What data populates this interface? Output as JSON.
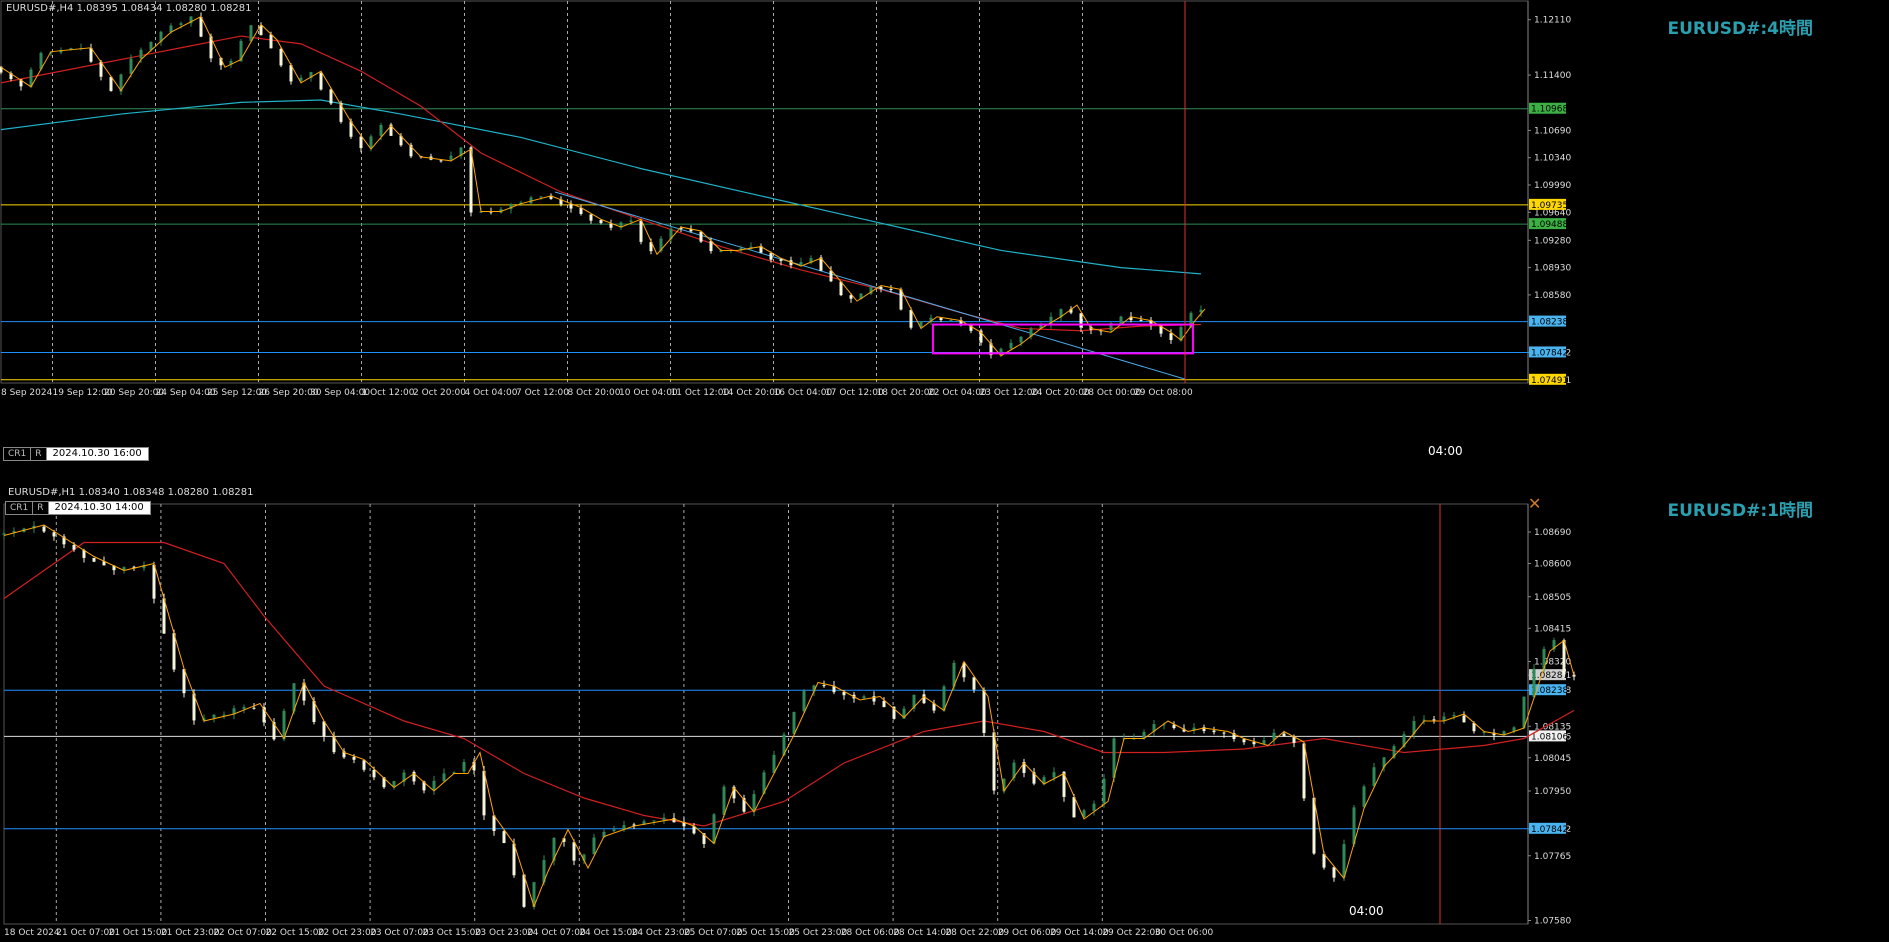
{
  "top": {
    "header": "EURUSD#,H4  1.08395 1.08434 1.08280 1.08281",
    "symbol_title": "EURUSD#:4時間",
    "cr_label": "CR1",
    "r_label": "R",
    "datetime_box": "2024.10.30 16:00",
    "cursor_time_label": "04:00"
  },
  "bottom": {
    "header": "EURUSD#,H1  1.08340 1.08348 1.08280 1.08281",
    "symbol_title": "EURUSD#:1時間",
    "cr_label": "CR1",
    "r_label": "R",
    "datetime_box": "2024.10.30 14:00",
    "cursor_time_label": "04:00"
  },
  "colors": {
    "background": "#000000",
    "bull_candle": "#2e8b57",
    "bear_candle": "#f5f5dc",
    "ma_red": "#d02020",
    "ma_cyan": "#20b2c8",
    "zigzag": "#ffa500",
    "hline_blue": "#1e90ff",
    "hline_green": "#2e8b57",
    "hline_yellow": "#ffd700",
    "magenta_box": "#ff00ff",
    "trendline": "#4aa8e8",
    "vertical_marker": "#e03030",
    "title_color": "#2a9fb0"
  },
  "chart_data": [
    {
      "type": "candlestick",
      "title": "EURUSD#:4時間",
      "timeframe": "H4",
      "ylim": [
        1.0745,
        1.1235
      ],
      "y_ticks": [
        "1.12110",
        "1.11400",
        "1.10690",
        "1.10340",
        "1.09990",
        "1.09640",
        "1.09280",
        "1.08930",
        "1.08580",
        "1.07842",
        "1.07491"
      ],
      "price_labels": [
        {
          "text": "1.10968",
          "price": 1.10968,
          "kind": "green"
        },
        {
          "text": "1.09735",
          "price": 1.09735,
          "kind": "yellow"
        },
        {
          "text": "1.09488",
          "price": 1.09488,
          "kind": "green"
        },
        {
          "text": "1.08238",
          "price": 1.08238,
          "kind": "blue"
        },
        {
          "text": "1.07842",
          "price": 1.07842,
          "kind": "blue"
        },
        {
          "text": "1.07491",
          "price": 1.07491,
          "kind": "yellow"
        }
      ],
      "x_ticks": [
        "8 Sep 2024",
        "19 Sep 12:00",
        "20 Sep 20:00",
        "24 Sep 04:00",
        "25 Sep 12:00",
        "26 Sep 20:00",
        "30 Sep 04:00",
        "1 Oct 12:00",
        "2 Oct 20:00",
        "4 Oct 04:00",
        "7 Oct 12:00",
        "8 Oct 20:00",
        "10 Oct 04:00",
        "11 Oct 12:00",
        "14 Oct 20:00",
        "16 Oct 04:00",
        "17 Oct 12:00",
        "18 Oct 20:00",
        "22 Oct 04:00",
        "23 Oct 12:00",
        "24 Oct 20:00",
        "28 Oct 00:00",
        "29 Oct 08:00"
      ],
      "path": [
        [
          0,
          1.115
        ],
        [
          15,
          1.1125
        ],
        [
          25,
          1.117
        ],
        [
          45,
          1.1175
        ],
        [
          60,
          1.112
        ],
        [
          70,
          1.116
        ],
        [
          85,
          1.1195
        ],
        [
          100,
          1.1215
        ],
        [
          112,
          1.115
        ],
        [
          120,
          1.116
        ],
        [
          130,
          1.1205
        ],
        [
          138,
          1.1185
        ],
        [
          150,
          1.113
        ],
        [
          160,
          1.1145
        ],
        [
          175,
          1.108
        ],
        [
          185,
          1.1045
        ],
        [
          195,
          1.1075
        ],
        [
          210,
          1.1035
        ],
        [
          225,
          1.103
        ],
        [
          235,
          1.1045
        ],
        [
          240,
          1.0965
        ],
        [
          250,
          1.0965
        ],
        [
          260,
          1.0975
        ],
        [
          275,
          1.0985
        ],
        [
          290,
          1.097
        ],
        [
          300,
          1.0955
        ],
        [
          310,
          1.0945
        ],
        [
          320,
          1.0955
        ],
        [
          328,
          1.091
        ],
        [
          340,
          1.0945
        ],
        [
          350,
          1.094
        ],
        [
          360,
          1.0915
        ],
        [
          368,
          1.0915
        ],
        [
          380,
          1.092
        ],
        [
          390,
          1.0905
        ],
        [
          400,
          1.0895
        ],
        [
          410,
          1.0905
        ],
        [
          420,
          1.0875
        ],
        [
          428,
          1.085
        ],
        [
          440,
          1.087
        ],
        [
          450,
          1.0865
        ],
        [
          460,
          1.0815
        ],
        [
          468,
          1.083
        ],
        [
          480,
          1.0825
        ],
        [
          490,
          1.081
        ],
        [
          500,
          1.078
        ],
        [
          510,
          1.0795
        ],
        [
          520,
          1.0815
        ],
        [
          530,
          1.083
        ],
        [
          538,
          1.0845
        ],
        [
          545,
          1.0815
        ],
        [
          555,
          1.081
        ],
        [
          565,
          1.083
        ],
        [
          575,
          1.0825
        ],
        [
          585,
          1.081
        ],
        [
          590,
          1.08
        ],
        [
          597,
          1.0825
        ],
        [
          602,
          1.084
        ]
      ],
      "ma_red": [
        [
          0,
          1.113
        ],
        [
          40,
          1.115
        ],
        [
          90,
          1.1175
        ],
        [
          120,
          1.119
        ],
        [
          150,
          1.118
        ],
        [
          180,
          1.1145
        ],
        [
          210,
          1.11
        ],
        [
          240,
          1.104
        ],
        [
          280,
          1.099
        ],
        [
          320,
          1.0955
        ],
        [
          360,
          1.092
        ],
        [
          400,
          1.089
        ],
        [
          440,
          1.0865
        ],
        [
          480,
          1.0835
        ],
        [
          510,
          1.0815
        ],
        [
          540,
          1.0812
        ],
        [
          570,
          1.0818
        ],
        [
          600,
          1.082
        ]
      ],
      "ma_cyan": [
        [
          0,
          1.107
        ],
        [
          60,
          1.109
        ],
        [
          120,
          1.1105
        ],
        [
          160,
          1.1108
        ],
        [
          200,
          1.109
        ],
        [
          260,
          1.106
        ],
        [
          320,
          1.102
        ],
        [
          380,
          1.0985
        ],
        [
          440,
          1.095
        ],
        [
          500,
          1.0915
        ],
        [
          560,
          1.0893
        ],
        [
          600,
          1.0885
        ]
      ],
      "magenta_box": {
        "x0": 466,
        "x1": 596,
        "y0": 1.0783,
        "y1": 1.082
      },
      "trendline": [
        [
          277,
          1.099
        ],
        [
          592,
          1.075
        ]
      ],
      "cursor_x": 592
    },
    {
      "type": "candlestick",
      "title": "EURUSD#:1時間",
      "timeframe": "H1",
      "ylim": [
        1.0757,
        1.0877
      ],
      "y_ticks": [
        "1.08690",
        "1.08600",
        "1.08505",
        "1.08415",
        "1.08320",
        "1.08281",
        "1.08238",
        "1.08135",
        "1.08106",
        "1.08045",
        "1.07950",
        "1.07842",
        "1.07765",
        "1.07580"
      ],
      "price_labels": [
        {
          "text": "1.08281",
          "price": 1.08281,
          "kind": "gray"
        },
        {
          "text": "1.08238",
          "price": 1.08238,
          "kind": "blue"
        },
        {
          "text": "1.08106",
          "price": 1.08106,
          "kind": "white"
        },
        {
          "text": "1.07842",
          "price": 1.07842,
          "kind": "blue"
        }
      ],
      "x_ticks": [
        "18 Oct 2024",
        "21 Oct 07:00",
        "21 Oct 15:00",
        "21 Oct 23:00",
        "22 Oct 07:00",
        "22 Oct 15:00",
        "22 Oct 23:00",
        "23 Oct 07:00",
        "23 Oct 15:00",
        "23 Oct 23:00",
        "24 Oct 07:00",
        "24 Oct 15:00",
        "24 Oct 23:00",
        "25 Oct 07:00",
        "25 Oct 15:00",
        "25 Oct 23:00",
        "28 Oct 06:00",
        "28 Oct 14:00",
        "28 Oct 22:00",
        "29 Oct 06:00",
        "29 Oct 14:00",
        "29 Oct 22:00",
        "30 Oct 06:00"
      ],
      "path": [
        [
          0,
          1.0868
        ],
        [
          20,
          1.0871
        ],
        [
          45,
          1.0862
        ],
        [
          60,
          1.0858
        ],
        [
          75,
          1.086
        ],
        [
          90,
          1.083
        ],
        [
          100,
          1.0815
        ],
        [
          115,
          1.0817
        ],
        [
          128,
          1.082
        ],
        [
          140,
          1.081
        ],
        [
          150,
          1.0826
        ],
        [
          160,
          1.0815
        ],
        [
          170,
          1.0806
        ],
        [
          180,
          1.0804
        ],
        [
          195,
          1.0796
        ],
        [
          205,
          1.08
        ],
        [
          215,
          1.0795
        ],
        [
          225,
          1.08
        ],
        [
          232,
          1.08
        ],
        [
          238,
          1.0806
        ],
        [
          245,
          1.0788
        ],
        [
          255,
          1.078
        ],
        [
          265,
          1.0762
        ],
        [
          272,
          1.0772
        ],
        [
          282,
          1.0784
        ],
        [
          292,
          1.0773
        ],
        [
          300,
          1.0782
        ],
        [
          315,
          1.0785
        ],
        [
          325,
          1.0786
        ],
        [
          335,
          1.0787
        ],
        [
          345,
          1.0785
        ],
        [
          355,
          1.078
        ],
        [
          365,
          1.0796
        ],
        [
          375,
          1.0789
        ],
        [
          385,
          1.08
        ],
        [
          395,
          1.0811
        ],
        [
          407,
          1.0826
        ],
        [
          415,
          1.0825
        ],
        [
          428,
          1.0821
        ],
        [
          438,
          1.0822
        ],
        [
          450,
          1.0816
        ],
        [
          460,
          1.0822
        ],
        [
          470,
          1.0818
        ],
        [
          480,
          1.0832
        ],
        [
          492,
          1.0822
        ],
        [
          500,
          1.0795
        ],
        [
          510,
          1.0803
        ],
        [
          520,
          1.0797
        ],
        [
          530,
          1.08
        ],
        [
          540,
          1.0787
        ],
        [
          552,
          1.0792
        ],
        [
          560,
          1.081
        ],
        [
          570,
          1.081
        ],
        [
          582,
          1.0815
        ],
        [
          592,
          1.0812
        ],
        [
          600,
          1.0813
        ],
        [
          612,
          1.0812
        ],
        [
          620,
          1.081
        ],
        [
          632,
          1.0808
        ],
        [
          640,
          1.0812
        ],
        [
          650,
          1.0809
        ],
        [
          660,
          1.0777
        ],
        [
          670,
          1.077
        ],
        [
          680,
          1.079
        ],
        [
          690,
          1.0802
        ],
        [
          700,
          1.0808
        ],
        [
          710,
          1.0815
        ],
        [
          720,
          1.0815
        ],
        [
          730,
          1.0817
        ],
        [
          740,
          1.0812
        ],
        [
          750,
          1.0811
        ],
        [
          760,
          1.0813
        ],
        [
          767,
          1.0825
        ],
        [
          773,
          1.0835
        ],
        [
          780,
          1.0838
        ],
        [
          785,
          1.0828
        ]
      ],
      "ma_red": [
        [
          0,
          1.085
        ],
        [
          40,
          1.0866
        ],
        [
          80,
          1.0866
        ],
        [
          110,
          1.086
        ],
        [
          130,
          1.0845
        ],
        [
          160,
          1.0825
        ],
        [
          200,
          1.0815
        ],
        [
          230,
          1.081
        ],
        [
          260,
          1.08
        ],
        [
          290,
          1.0793
        ],
        [
          320,
          1.0788
        ],
        [
          350,
          1.0785
        ],
        [
          390,
          1.0792
        ],
        [
          420,
          1.0803
        ],
        [
          460,
          1.0812
        ],
        [
          490,
          1.0815
        ],
        [
          520,
          1.0812
        ],
        [
          550,
          1.0806
        ],
        [
          580,
          1.0806
        ],
        [
          620,
          1.0807
        ],
        [
          660,
          1.081
        ],
        [
          700,
          1.0806
        ],
        [
          740,
          1.0808
        ],
        [
          760,
          1.081
        ],
        [
          785,
          1.0818
        ]
      ],
      "cursor_x": 718
    }
  ]
}
